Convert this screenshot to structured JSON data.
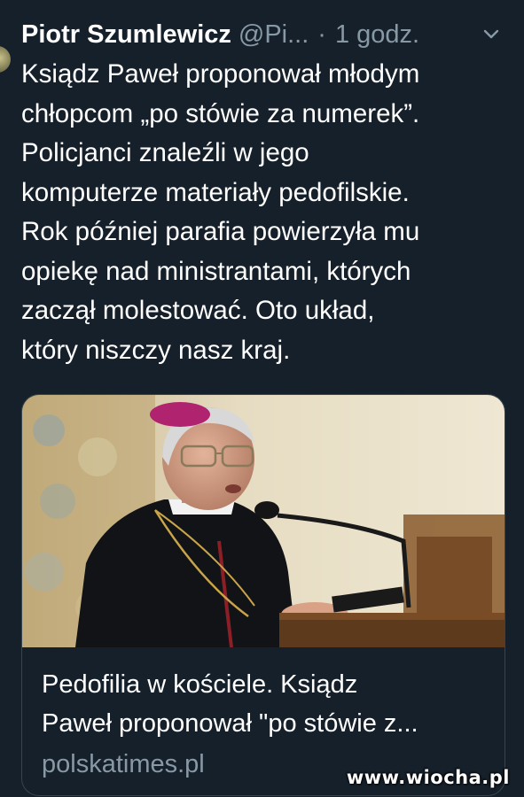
{
  "tweet": {
    "author_name": "Piotr Szumlewicz",
    "handle": "@Pi...",
    "separator": "·",
    "time": "1 godz.",
    "text_lines": [
      "Ksiądz Paweł proponował młodym",
      "chłopcom „po stówie za numerek”.",
      "Policjanci znaleźli w jego",
      "komputerze materiały pedofilskie.",
      "Rok później parafia powierzyła mu",
      "opiekę nad ministrantami, których",
      "zaczął molestować. Oto układ,",
      "który niszczy nasz kraj."
    ]
  },
  "card": {
    "title_lines": [
      "Pedofilia w kościele. Ksiądz",
      "Paweł proponował \"po stówie z..."
    ],
    "domain": "polskatimes.pl"
  },
  "watermark": "www.wiocha.pl",
  "icons": {
    "menu": "chevron-down-icon"
  },
  "colors": {
    "background": "#15202b",
    "text": "#ffffff",
    "muted": "#8899a6",
    "card_border": "#38444d"
  }
}
